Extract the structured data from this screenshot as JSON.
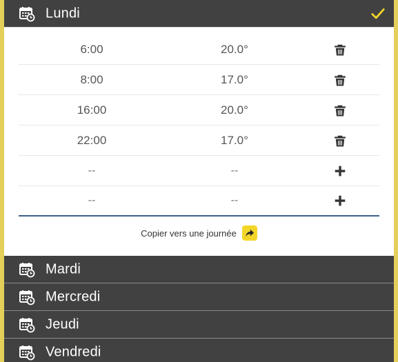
{
  "days": {
    "expanded": {
      "label": "Lundi"
    },
    "collapsed": [
      {
        "label": "Mardi"
      },
      {
        "label": "Mercredi"
      },
      {
        "label": "Jeudi"
      },
      {
        "label": "Vendredi"
      }
    ]
  },
  "schedule": {
    "rows": [
      {
        "time": "6:00",
        "temp": "20.0°",
        "action": "delete-icon"
      },
      {
        "time": "8:00",
        "temp": "17.0°",
        "action": "delete-icon"
      },
      {
        "time": "16:00",
        "temp": "20.0°",
        "action": "delete-icon"
      },
      {
        "time": "22:00",
        "temp": "17.0°",
        "action": "delete-icon"
      },
      {
        "time": "--",
        "temp": "--",
        "action": "plus-icon"
      },
      {
        "time": "--",
        "temp": "--",
        "action": "plus-icon"
      }
    ]
  },
  "copy": {
    "label": "Copier vers une journée",
    "icon": "share-arrow-icon"
  },
  "colors": {
    "accent": "#f4d629",
    "header_bg": "#414141",
    "frame_border": "#e3cf5a",
    "divider_blue": "#3c5f86"
  }
}
